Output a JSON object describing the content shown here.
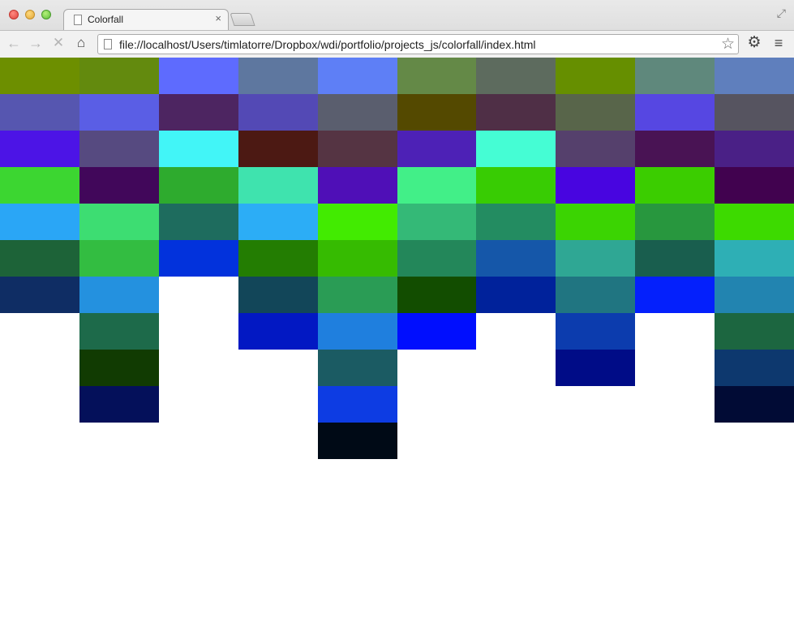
{
  "tab": {
    "title": "Colorfall",
    "close_glyph": "×"
  },
  "toolbar": {
    "back_glyph": "←",
    "forward_glyph": "→",
    "stop_glyph": "✕",
    "home_glyph": "⌂",
    "gear_glyph": "⚙",
    "menu_glyph": "≡"
  },
  "omnibox": {
    "url": "file://localhost/Users/timlatorre/Dropbox/wdi/portfolio/projects_js/colorfall/index.html",
    "star_glyph": "☆"
  },
  "fullscreen_glyph": "⤢",
  "colorfall": {
    "columns": [
      [
        "#6d8f00",
        "#5656b0",
        "#4c14e6",
        "#3cd631",
        "#2aa6f6",
        "#1d6338",
        "#0f2d64"
      ],
      [
        "#638a0e",
        "#5a5ee5",
        "#564a80",
        "#41075a",
        "#3ddd72",
        "#33bd41",
        "#2491df",
        "#1d6a4a",
        "#113b02",
        "#04105a"
      ],
      [
        "#5e6bfe",
        "#4d2561",
        "#42f5f7",
        "#2eab2e",
        "#1e6c5e",
        "#0232dc"
      ],
      [
        "#5e779f",
        "#5349b5",
        "#4c1913",
        "#3fe3ae",
        "#2cadf6",
        "#237d02",
        "#124659",
        "#0218c3"
      ],
      [
        "#5e7ff6",
        "#5a5e6e",
        "#553443",
        "#4f0fb7",
        "#42eb01",
        "#36bb01",
        "#2a9c55",
        "#1f7fde",
        "#1b5b63",
        "#0d3ce3",
        "#000a16"
      ],
      [
        "#648947",
        "#544900",
        "#4d21b6",
        "#42ef88",
        "#34b977",
        "#23875a",
        "#124d00",
        "#000efe"
      ],
      [
        "#5d6b5e",
        "#4f2f46",
        "#45fdd4",
        "#38cc03",
        "#238c61",
        "#1557a9",
        "#00229b"
      ],
      [
        "#668f00",
        "#58654a",
        "#55406c",
        "#4805e0",
        "#3bd402",
        "#2fa794",
        "#207581",
        "#0c3cae",
        "#000c87"
      ],
      [
        "#5f887c",
        "#5647e2",
        "#491354",
        "#3bcd00",
        "#28973e",
        "#195e4e",
        "#0420fc"
      ],
      [
        "#5f7fbd",
        "#565460",
        "#4a2086",
        "#41024f",
        "#3dda00",
        "#2eafb5",
        "#2284b0",
        "#1c6640",
        "#0d386e",
        "#010b35"
      ]
    ]
  }
}
